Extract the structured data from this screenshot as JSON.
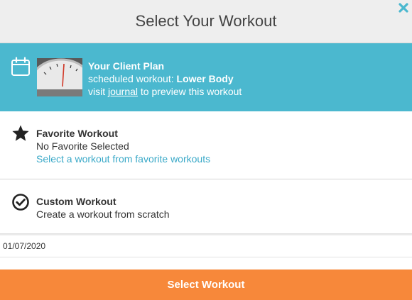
{
  "header": {
    "title": "Select Your Workout",
    "close_icon": "close-icon"
  },
  "client_plan": {
    "icon": "calendar-icon",
    "title": "Your Client Plan",
    "scheduled_prefix": "scheduled workout: ",
    "scheduled_value": "Lower Body",
    "visit_prefix": "visit ",
    "journal_link": "journal",
    "visit_suffix": " to preview this workout",
    "thumbnail": "scale-thumbnail",
    "background_color": "#4bb8cf"
  },
  "favorite": {
    "icon": "star-icon",
    "title": "Favorite Workout",
    "status": "No Favorite Selected",
    "link": "Select a workout from favorite workouts",
    "link_color": "#3aa9c8"
  },
  "custom": {
    "icon": "check-circle-icon",
    "title": "Custom Workout",
    "description": "Create a workout from scratch"
  },
  "date_field": {
    "value": "01/07/2020"
  },
  "footer": {
    "button_label": "Select Workout",
    "button_color": "#f7883a"
  }
}
